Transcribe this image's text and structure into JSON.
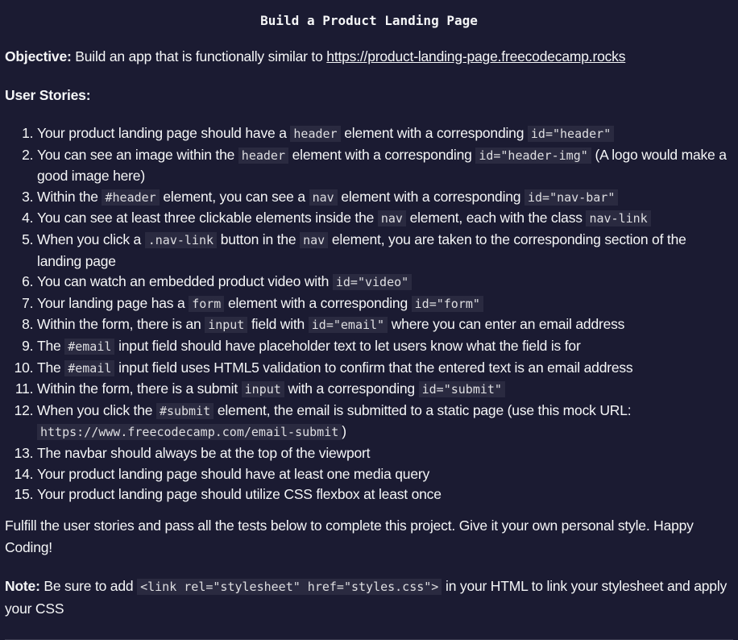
{
  "title": "Build a Product Landing Page",
  "objective": {
    "label": "Objective:",
    "text": " Build an app that is functionally similar to ",
    "link": "https://product-landing-page.freecodecamp.rocks"
  },
  "user_stories_label": "User Stories:",
  "stories": [
    [
      {
        "t": "Your product landing page should have a "
      },
      {
        "c": "header"
      },
      {
        "t": " element with a corresponding "
      },
      {
        "c": "id=\"header\""
      }
    ],
    [
      {
        "t": "You can see an image within the "
      },
      {
        "c": "header"
      },
      {
        "t": " element with a corresponding "
      },
      {
        "c": "id=\"header-img\""
      },
      {
        "t": " (A logo would make a good image here)"
      }
    ],
    [
      {
        "t": "Within the "
      },
      {
        "c": "#header"
      },
      {
        "t": " element, you can see a "
      },
      {
        "c": "nav"
      },
      {
        "t": " element with a corresponding "
      },
      {
        "c": "id=\"nav-bar\""
      }
    ],
    [
      {
        "t": "You can see at least three clickable elements inside the "
      },
      {
        "c": "nav"
      },
      {
        "t": " element, each with the class "
      },
      {
        "c": "nav-link"
      }
    ],
    [
      {
        "t": "When you click a "
      },
      {
        "c": ".nav-link"
      },
      {
        "t": " button in the "
      },
      {
        "c": "nav"
      },
      {
        "t": " element, you are taken to the corresponding section of the landing page"
      }
    ],
    [
      {
        "t": "You can watch an embedded product video with "
      },
      {
        "c": "id=\"video\""
      }
    ],
    [
      {
        "t": "Your landing page has a "
      },
      {
        "c": "form"
      },
      {
        "t": " element with a corresponding "
      },
      {
        "c": "id=\"form\""
      }
    ],
    [
      {
        "t": "Within the form, there is an "
      },
      {
        "c": "input"
      },
      {
        "t": " field with "
      },
      {
        "c": "id=\"email\""
      },
      {
        "t": " where you can enter an email address"
      }
    ],
    [
      {
        "t": "The "
      },
      {
        "c": "#email"
      },
      {
        "t": " input field should have placeholder text to let users know what the field is for"
      }
    ],
    [
      {
        "t": "The "
      },
      {
        "c": "#email"
      },
      {
        "t": " input field uses HTML5 validation to confirm that the entered text is an email address"
      }
    ],
    [
      {
        "t": "Within the form, there is a submit "
      },
      {
        "c": "input"
      },
      {
        "t": " with a corresponding "
      },
      {
        "c": "id=\"submit\""
      }
    ],
    [
      {
        "t": "When you click the "
      },
      {
        "c": "#submit"
      },
      {
        "t": " element, the email is submitted to a static page (use this mock URL: "
      },
      {
        "c": "https://www.freecodecamp.com/email-submit"
      },
      {
        "t": ")"
      }
    ],
    [
      {
        "t": "The navbar should always be at the top of the viewport"
      }
    ],
    [
      {
        "t": "Your product landing page should have at least one media query"
      }
    ],
    [
      {
        "t": "Your product landing page should utilize CSS flexbox at least once"
      }
    ]
  ],
  "fulfill": "Fulfill the user stories and pass all the tests below to complete this project. Give it your own personal style. Happy Coding!",
  "note": {
    "label": "Note:",
    "text_before": " Be sure to add ",
    "code": "<link rel=\"stylesheet\" href=\"styles.css\">",
    "text_after": " in your HTML to link your stylesheet and apply your CSS"
  }
}
